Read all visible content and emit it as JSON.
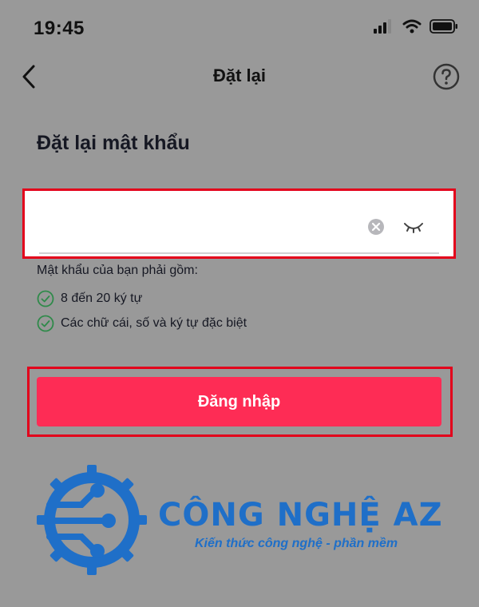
{
  "status_bar": {
    "time": "19:45",
    "icons": [
      "signal-icon",
      "wifi-icon",
      "battery-icon"
    ]
  },
  "nav": {
    "title": "Đặt lại",
    "back_icon": "chevron-left-icon",
    "help_icon": "help-icon"
  },
  "heading": "Đặt lại mật khẩu",
  "password_field": {
    "value": "",
    "placeholder": "",
    "clear_icon": "clear-icon",
    "visibility_icon": "eye-closed-icon"
  },
  "requirements": {
    "title": "Mật khẩu của bạn phải gồm:",
    "items": [
      {
        "text": "8 đến 20 ký tự",
        "icon": "check-circle-icon",
        "met": true
      },
      {
        "text": "Các chữ cái, số và ký tự đặc biệt",
        "icon": "check-circle-icon",
        "met": true
      }
    ]
  },
  "login_button": {
    "label": "Đăng nhập"
  },
  "watermark": {
    "brand": "CÔNG NGHỆ AZ",
    "tagline": "Kiến thức công nghệ - phần mềm"
  },
  "colors": {
    "background": "#999999",
    "accent": "#fe2c55",
    "highlight_border": "#e3001b",
    "check_green": "#2f8a4a",
    "watermark_blue": "#1f6fc8"
  }
}
